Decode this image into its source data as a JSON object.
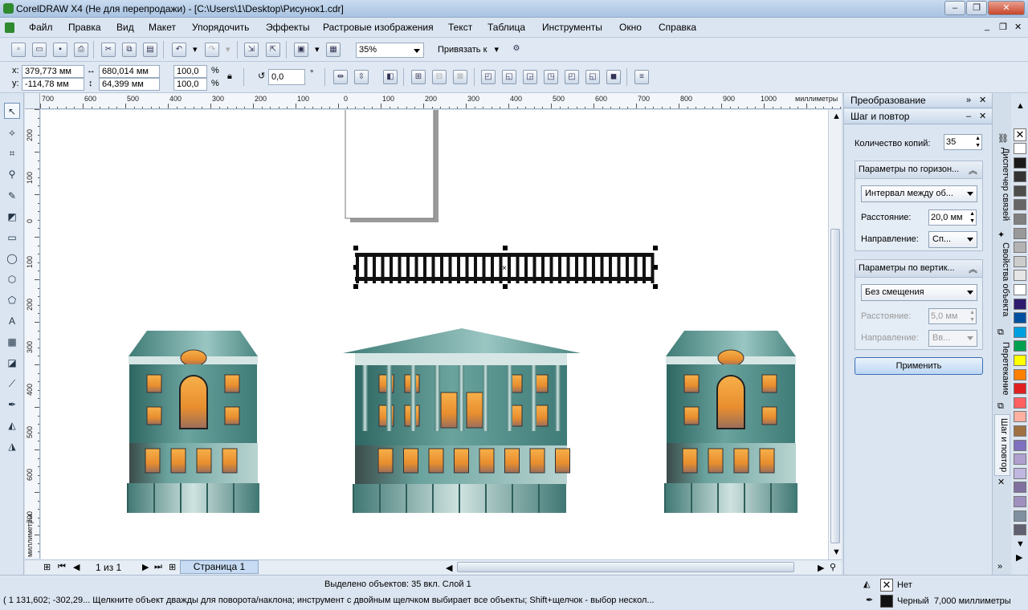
{
  "app": {
    "title": "CorelDRAW X4 (Не для перепродажи) - [C:\\Users\\1\\Desktop\\Рисунок1.cdr]"
  },
  "menu": [
    "Файл",
    "Правка",
    "Вид",
    "Макет",
    "Упорядочить",
    "Эффекты",
    "Растровые изображения",
    "Текст",
    "Таблица",
    "Инструменты",
    "Окно",
    "Справка"
  ],
  "toolbar": {
    "zoom": "35%",
    "snap_label": "Привязать к"
  },
  "property_bar": {
    "x_label": "x:",
    "x": "379,773 мм",
    "y_label": "y:",
    "y": "-114,78 мм",
    "w": "680,014 мм",
    "h": "64,399 мм",
    "scale_w": "100,0",
    "scale_h": "100,0",
    "pct": "%",
    "rotation": "0,0",
    "deg": "°"
  },
  "ruler": {
    "units": "миллиметры",
    "top_labels": [
      "700",
      "600",
      "500",
      "400",
      "300",
      "200",
      "100",
      "0",
      "100",
      "200",
      "300",
      "400",
      "500",
      "600",
      "700",
      "800",
      "900",
      "1000"
    ],
    "left_labels": [
      "200",
      "100",
      "0",
      "100",
      "200",
      "300",
      "400",
      "500",
      "600",
      "700"
    ]
  },
  "page_nav": {
    "pages": "1 из 1",
    "tab": "Страница 1"
  },
  "docker": {
    "header1": "Преобразование",
    "header2": "Шаг и повтор",
    "copies_label": "Количество копий:",
    "copies_value": "35",
    "horiz_group": "Параметры по горизон...",
    "horiz_mode": "Интервал между об...",
    "horiz_dist_label": "Расстояние:",
    "horiz_dist": "20,0 мм",
    "horiz_dir_label": "Направление:",
    "horiz_dir": "Сп...",
    "vert_group": "Параметры по вертик...",
    "vert_mode": "Без смещения",
    "vert_dist_label": "Расстояние:",
    "vert_dist": "5,0 мм",
    "vert_dir_label": "Направление:",
    "vert_dir": "Вв...",
    "apply": "Применить"
  },
  "vtabs": [
    "Диспетчер связей",
    "Свойства объекта",
    "Перетекание",
    "Шаг и повтор"
  ],
  "palette": [
    "#ffffff",
    "#1a1a1a",
    "#333333",
    "#4d4d4d",
    "#666666",
    "#808080",
    "#999999",
    "#b3b3b3",
    "#cccccc",
    "#e6e6e6",
    "#ffffff",
    "#2d1b6e",
    "#0050a0",
    "#00a0e0",
    "#00a050",
    "#ffff00",
    "#ff8000",
    "#e02020",
    "#ff6060",
    "#ffb0a0",
    "#a07040",
    "#8070c0",
    "#b0a0d0",
    "#c0b8e0",
    "#8070a0",
    "#a090c0",
    "#8090a0",
    "#606070"
  ],
  "colors": {
    "accent": "#3c6fb4",
    "building": "#4f8c88",
    "window": "#f0902a"
  },
  "status": {
    "selected": "Выделено объектов: 35 вкл. Слой 1",
    "hint": "( 1 131,602; -302,29... Щелкните объект дважды для поворота/наклона; инструмент с двойным щелчком выбирает все объекты; Shift+щелчок - выбор нескол...",
    "fill": "Нет",
    "outline": "Черный",
    "outline_width": "7,000 миллиметры"
  }
}
